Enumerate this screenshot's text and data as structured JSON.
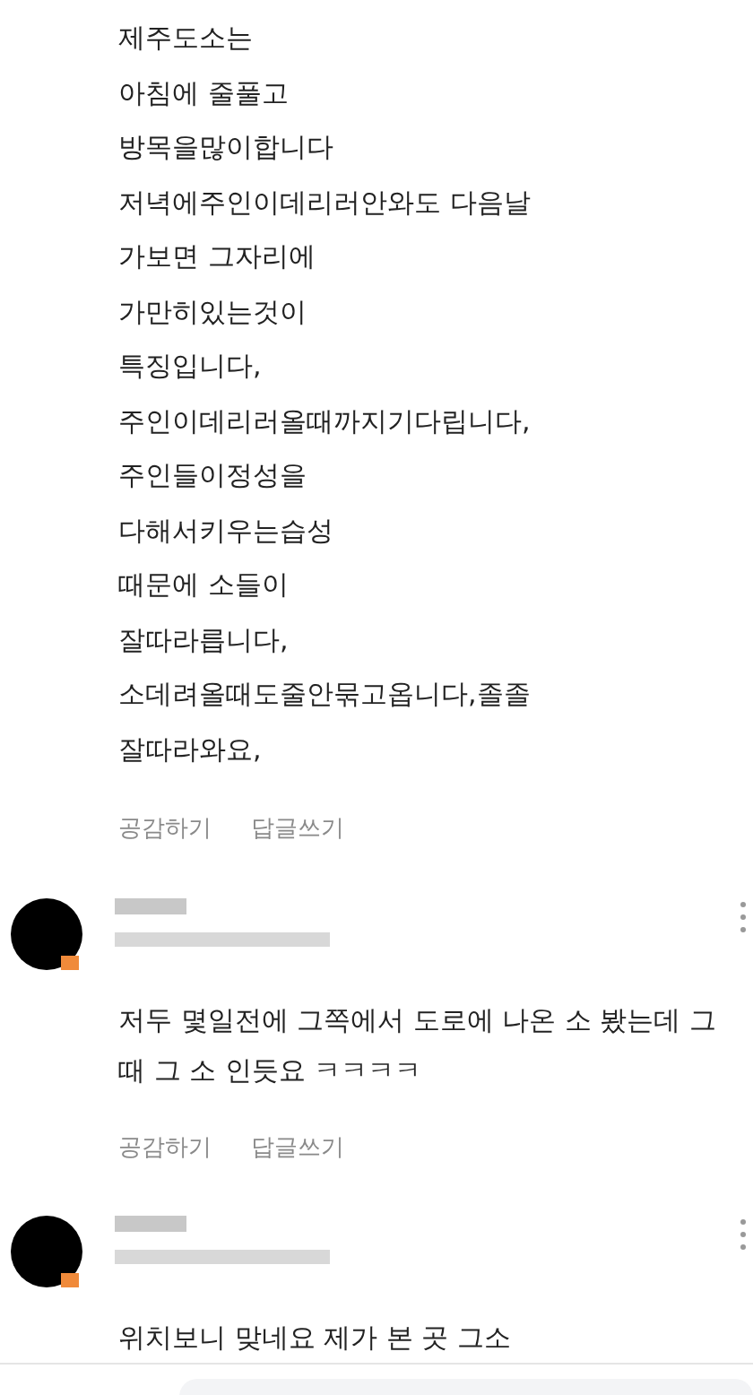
{
  "comments": [
    {
      "kind": "continuation",
      "lines": [
        "제주도소는",
        "아침에 줄풀고",
        "방목을많이합니다",
        "저녁에주인이데리러안와도 다음날",
        "가보면 그자리에",
        "가만히있는것이",
        "특징입니다,",
        "주인이데리러올때까지기다립니다,",
        "주인들이정성을",
        "다해서키우는습성",
        "때문에 소들이",
        "잘따라릅니다,",
        "소데려올때도줄안묶고옵니다,졸졸",
        "잘따라와요,"
      ],
      "actions": [
        "공감하기",
        "답글쓰기"
      ]
    },
    {
      "kind": "full",
      "lines": [
        "저두 몇일전에 그쪽에서 도로에 나온 소 봤는데 그",
        "때 그 소 인듯요 ㅋㅋㅋㅋ"
      ],
      "actions": [
        "공감하기",
        "답글쓰기"
      ]
    },
    {
      "kind": "full",
      "lines": [
        "위치보니 맞네요 제가 본 곳 그소"
      ]
    }
  ]
}
